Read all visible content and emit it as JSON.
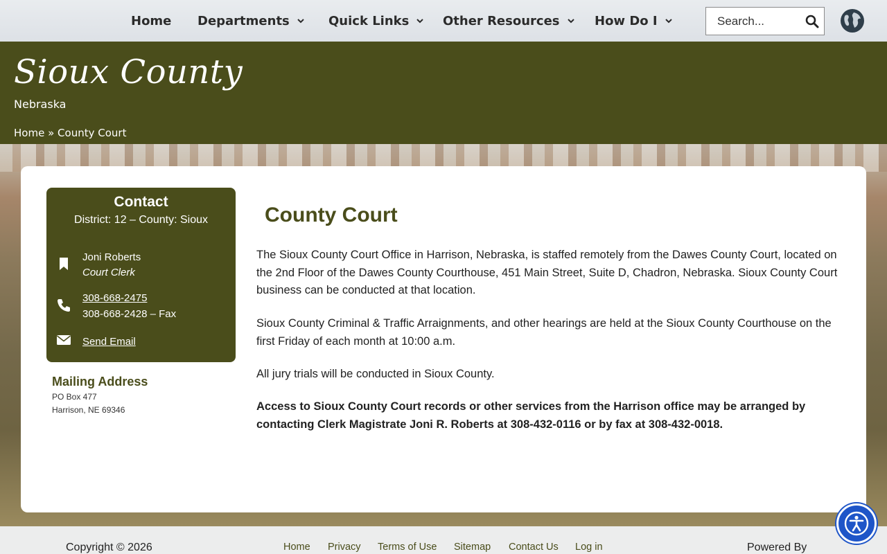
{
  "nav": {
    "items": [
      {
        "label": "Home",
        "has_dropdown": false
      },
      {
        "label": "Departments",
        "has_dropdown": true
      },
      {
        "label": "Quick Links",
        "has_dropdown": true
      },
      {
        "label": "Other Resources",
        "has_dropdown": true
      },
      {
        "label": "How Do I",
        "has_dropdown": true
      }
    ],
    "search_placeholder": "Search..."
  },
  "header": {
    "title": "Sioux County",
    "subtitle": "Nebraska",
    "breadcrumb": {
      "home": "Home",
      "separator": "»",
      "current": "County Court"
    }
  },
  "contact": {
    "title": "Contact",
    "district": "District: 12 – County: Sioux",
    "name": "Joni Roberts",
    "role": "Court Clerk",
    "phone": "308-668-2475",
    "fax": "308-668-2428 – Fax",
    "email_label": "Send Email"
  },
  "mailing": {
    "title": "Mailing Address",
    "line1": "PO Box 477",
    "line2": "Harrison, NE 69346"
  },
  "article": {
    "title": "County Court",
    "p1": "The Sioux County Court Office in Harrison, Nebraska, is staffed remotely from the Dawes County Court, located on the 2nd Floor of the Dawes County Courthouse, 451 Main Street, Suite D, Chadron, Nebraska. Sioux County Court business can be conducted at that location.",
    "p2": "Sioux County Criminal & Traffic Arraignments, and other hearings are held at the Sioux County Courthouse on the first Friday of each month at 10:00 a.m.",
    "p3": "All jury trials will be conducted in Sioux County.",
    "p4": "Access to Sioux County Court records or other services from the Harrison office may be arranged by contacting Clerk Magistrate Joni R. Roberts at 308-432-0116 or by fax at 308-432-0018."
  },
  "footer": {
    "copyright": "Copyright © 2026",
    "links": [
      "Home",
      "Privacy",
      "Terms of Use",
      "Sitemap",
      "Contact Us",
      "Log in"
    ],
    "powered": "Powered By"
  },
  "colors": {
    "brand_olive": "#4a4d1b",
    "accessibility_blue": "#1e55c8"
  },
  "icons": [
    "chevron-down-icon",
    "search-icon",
    "globe-icon",
    "bookmark-icon",
    "phone-icon",
    "envelope-icon",
    "accessibility-icon"
  ]
}
